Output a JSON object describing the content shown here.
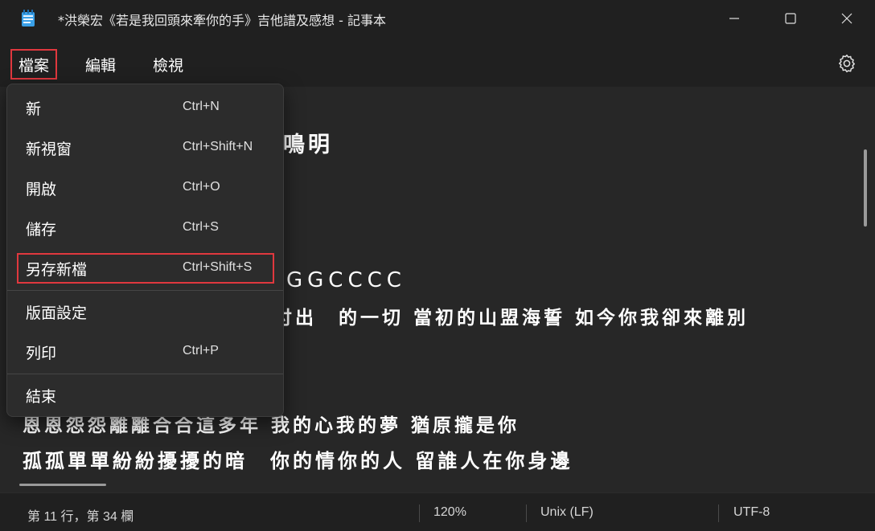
{
  "window": {
    "title": "*洪榮宏《若是我回頭來牽你的手》吉他譜及感想 - 記事本",
    "app_icon": "notepad-icon",
    "controls": [
      "minimize-icon",
      "maximize-icon",
      "close-icon"
    ]
  },
  "menubar": {
    "file": "檔案",
    "edit": "編輯",
    "view": "檢視",
    "settings_icon": "gear-icon"
  },
  "file_menu": {
    "items": [
      {
        "label": "新",
        "shortcut": "Ctrl+N"
      },
      {
        "label": "新視窗",
        "shortcut": "Ctrl+Shift+N"
      },
      {
        "label": "開啟",
        "shortcut": "Ctrl+O"
      },
      {
        "label": "儲存",
        "shortcut": "Ctrl+S"
      },
      {
        "label": "另存新檔",
        "shortcut": "Ctrl+Shift+S"
      },
      {
        "label": "版面設定",
        "shortcut": ""
      },
      {
        "label": "列印",
        "shortcut": "Ctrl+P"
      },
      {
        "label": "結束",
        "shortcut": ""
      }
    ]
  },
  "editor": {
    "visible_fragments": {
      "line1_tail": "鳴明",
      "line2_tail": "：",
      "line3_tail": "GGCCCC",
      "line4_tail": "付出　的一切 當初的山盟海誓 如今你我卻來離別",
      "line5": "恩恩怨怨離離合合這多年 我的心我的夢 猶原攏是你",
      "line6": "孤孤單單紛紛擾擾的暗　你的情你的人 留誰人在你身邊"
    }
  },
  "statusbar": {
    "position": "第 11 行，第 34 欄",
    "zoom": "120%",
    "line_ending": "Unix (LF)",
    "encoding": "UTF-8"
  },
  "colors": {
    "background": "#202020",
    "editor": "#272727",
    "menu": "#2c2c2c",
    "highlight": "#e0383e"
  }
}
